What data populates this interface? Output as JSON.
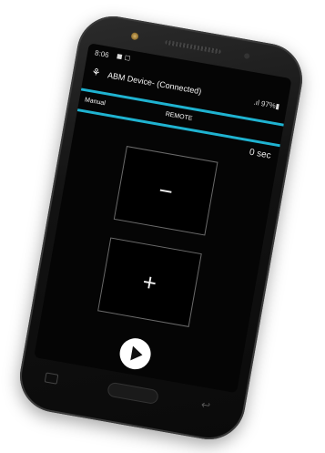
{
  "status_bar": {
    "time": "8:06",
    "icons": "◼ ◻",
    "battery": ".ıl 97%▮"
  },
  "app_bar": {
    "app_icon": "⚘",
    "title": "ABM Device- (Connected)"
  },
  "tabs": [
    {
      "label": "Manual"
    },
    {
      "label": "REMOTE"
    }
  ],
  "timer": "0 sec",
  "controls": {
    "minus_label": "−",
    "plus_label": "+"
  },
  "accent_color": "#1fb3d1",
  "nav": {
    "back_icon": "↩"
  }
}
